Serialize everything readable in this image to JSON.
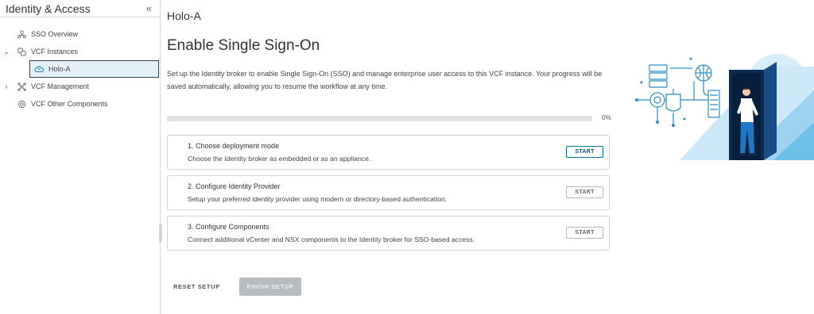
{
  "sidebar": {
    "title": "Identity & Access",
    "collapse_icon": "double-chevron-left-icon",
    "items": [
      {
        "label": "SSO Overview",
        "icon": "sso-overview-icon"
      },
      {
        "label": "VCF Instances",
        "icon": "vcf-instances-icon",
        "expanded": true
      },
      {
        "label": "Holo-A",
        "icon": "cloud-icon",
        "selected": true
      },
      {
        "label": "VCF Management",
        "icon": "vcf-management-icon",
        "expanded": false
      },
      {
        "label": "VCF Other Components",
        "icon": "components-icon"
      }
    ]
  },
  "main": {
    "heading": "Holo-A",
    "title": "Enable Single Sign-On",
    "intro": "Set up the Identity broker to enable Single Sign-On (SSO) and manage enterprise user access to this VCF instance. Your progress will be saved automatically, allowing you to resume the workflow at any time.",
    "progress": {
      "value": 0,
      "label": "0%"
    },
    "steps": [
      {
        "title": "1. Choose deployment mode",
        "description": "Choose the Identity broker as embedded or as an appliance.",
        "button": "START",
        "active": true
      },
      {
        "title": "2. Configure Identity Provider",
        "description": "Setup your preferred identity provider using modern or directory-based authentication.",
        "button": "START",
        "active": false
      },
      {
        "title": "3. Configure Components",
        "description": "Connect additional vCenter and NSX components to the Identity broker for SSO-based access.",
        "button": "START",
        "active": false
      }
    ],
    "reset_label": "RESET SETUP",
    "finish_label": "FINISH SETUP"
  },
  "colors": {
    "accent": "#0072a3",
    "selected_bg": "#e4f1f8",
    "selected_border": "#2a4864",
    "disabled_button": "#b9bcbe",
    "progress_track": "#e1e4e6"
  }
}
